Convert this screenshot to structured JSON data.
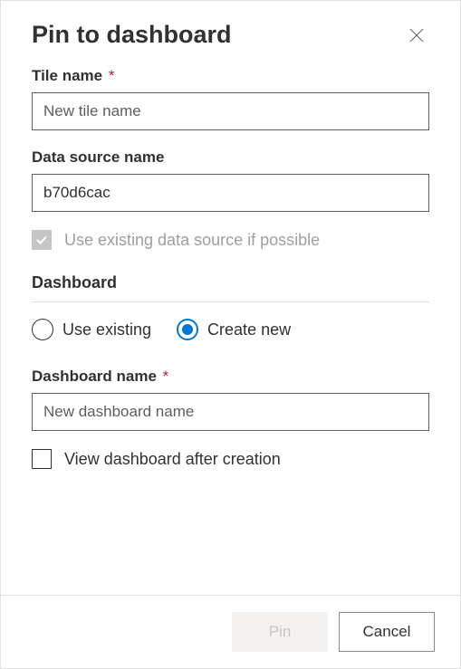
{
  "dialog": {
    "title": "Pin to dashboard"
  },
  "tile_name": {
    "label": "Tile name",
    "required_mark": "*",
    "placeholder": "New tile name",
    "value": ""
  },
  "data_source": {
    "label": "Data source name",
    "value": "b70d6cac"
  },
  "use_existing_ds": {
    "label": "Use existing data source if possible",
    "checked": true,
    "disabled": true
  },
  "dashboard_section": {
    "heading": "Dashboard",
    "options": {
      "use_existing": "Use existing",
      "create_new": "Create new"
    },
    "selected": "create_new"
  },
  "dashboard_name": {
    "label": "Dashboard name",
    "required_mark": "*",
    "placeholder": "New dashboard name",
    "value": ""
  },
  "view_after": {
    "label": "View dashboard after creation",
    "checked": false
  },
  "actions": {
    "pin": "Pin",
    "cancel": "Cancel"
  }
}
